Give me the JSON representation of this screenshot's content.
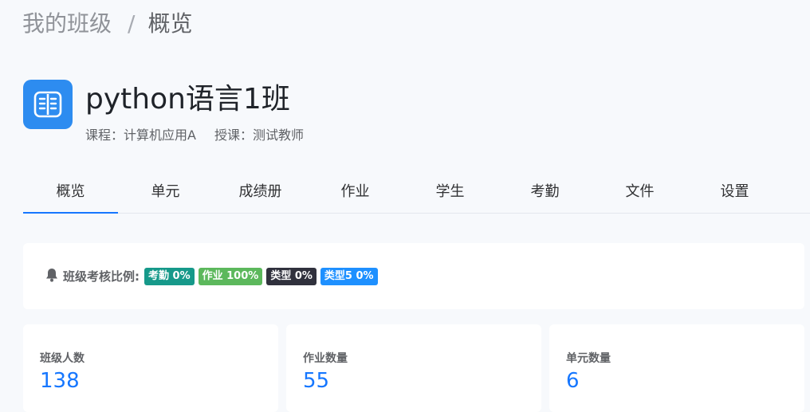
{
  "breadcrumb": {
    "parent": "我的班级",
    "separator": "/",
    "current": "概览"
  },
  "class": {
    "title": "python语言1班",
    "course": "课程：计算机应用A",
    "teacher": "授课：测试教师",
    "icon": "book-open-icon"
  },
  "tabs": [
    {
      "label": "概览",
      "active": true
    },
    {
      "label": "单元"
    },
    {
      "label": "成绩册"
    },
    {
      "label": "作业"
    },
    {
      "label": "学生"
    },
    {
      "label": "考勤"
    },
    {
      "label": "文件"
    },
    {
      "label": "设置"
    }
  ],
  "assessment": {
    "label": "班级考核比例:",
    "icon": "bell-icon",
    "tags": [
      {
        "text": "考勤 0%",
        "color": "#16998a"
      },
      {
        "text": "作业 100%",
        "color": "#5cb85c"
      },
      {
        "text": "类型 0%",
        "color": "#30313d"
      },
      {
        "text": "类型5 0%",
        "color": "#1e90ff"
      }
    ]
  },
  "stats": [
    {
      "label": "班级人数",
      "value": "138"
    },
    {
      "label": "作业数量",
      "value": "55"
    },
    {
      "label": "单元数量",
      "value": "6"
    }
  ],
  "colors": {
    "accent": "#1677ff",
    "icon_bg": "#2d8cf0"
  }
}
